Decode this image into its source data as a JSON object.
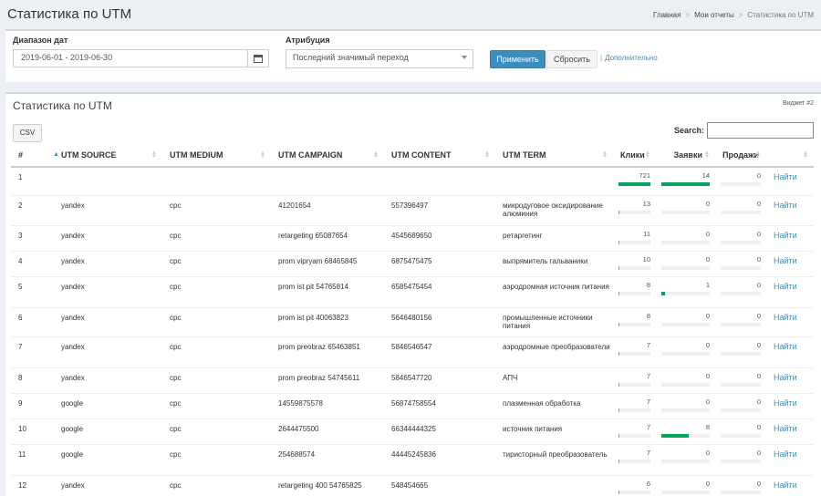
{
  "page_title": "Статистика по UTM",
  "breadcrumb": [
    "Главная",
    "Мои отчеты",
    "Статистика по UTM"
  ],
  "filters": {
    "date_label": "Диапазон дат",
    "date_value": "2019-06-01 - 2019-06-30",
    "attr_label": "Атрибуция",
    "attr_value": "Последний значимый переход",
    "apply": "Применить",
    "reset": "Сбросить",
    "more": "Дополнительно"
  },
  "box": {
    "title": "Статистика по UTM",
    "widget_id": "Виджет #2",
    "csv": "CSV",
    "search_label": "Search:",
    "search_value": ""
  },
  "columns": [
    "#",
    "UTM SOURCE",
    "UTM MEDIUM",
    "UTM CAMPAIGN",
    "UTM CONTENT",
    "UTM TERM",
    "Клики",
    "Заявки",
    "Продажи",
    ""
  ],
  "action_label": "Найти",
  "max": {
    "clicks": 721,
    "leads": 14,
    "sales": 1
  },
  "rows": [
    {
      "n": "1",
      "source": "",
      "medium": "",
      "campaign": "",
      "content": "",
      "term": "",
      "clicks": 721,
      "leads": 14,
      "sales": 0
    },
    {
      "n": "2",
      "source": "yandex",
      "medium": "cpc",
      "campaign": "41201654",
      "content": "557396497",
      "term": "микродуговое оксидирование алюминия",
      "clicks": 13,
      "leads": 0,
      "sales": 0
    },
    {
      "n": "3",
      "source": "yandex",
      "medium": "cpc",
      "campaign": "retargeting 65087654",
      "content": "4545689650",
      "term": "ретаргетинг",
      "clicks": 11,
      "leads": 0,
      "sales": 0
    },
    {
      "n": "4",
      "source": "yandex",
      "medium": "cpc",
      "campaign": "prom vipryam 68465845",
      "content": "6875475475",
      "term": "выпрямитель гальваники",
      "clicks": 10,
      "leads": 0,
      "sales": 0
    },
    {
      "n": "5",
      "source": "yandex",
      "medium": "cpc",
      "campaign": "prom ist pit 54765814",
      "content": "6585475454",
      "term": "аэродромная источник питания",
      "clicks": 8,
      "leads": 1,
      "sales": 0
    },
    {
      "n": "6",
      "source": "yandex",
      "medium": "cpc",
      "campaign": "prom ist pit 40063823",
      "content": "5646480156",
      "term": "промышленные источники питания",
      "clicks": 8,
      "leads": 0,
      "sales": 0
    },
    {
      "n": "7",
      "source": "yandex",
      "medium": "cpc",
      "campaign": "prom preobraz 65463851",
      "content": "5846546547",
      "term": "аэродромные преобразователи",
      "clicks": 7,
      "leads": 0,
      "sales": 0
    },
    {
      "n": "8",
      "source": "yandex",
      "medium": "cpc",
      "campaign": "prom preobraz 54745611",
      "content": "5846547720",
      "term": "АПЧ",
      "clicks": 7,
      "leads": 0,
      "sales": 0
    },
    {
      "n": "9",
      "source": "google",
      "medium": "cpc",
      "campaign": "14559875578",
      "content": "56874758554",
      "term": "плазменная обработка",
      "clicks": 7,
      "leads": 0,
      "sales": 0
    },
    {
      "n": "10",
      "source": "google",
      "medium": "cpc",
      "campaign": "2644475500",
      "content": "66344444325",
      "term": "источник питания",
      "clicks": 7,
      "leads": 8,
      "sales": 0
    },
    {
      "n": "11",
      "source": "google",
      "medium": "cpc",
      "campaign": "254688574",
      "content": "44445245836",
      "term": "тиристорный преобразователь",
      "clicks": 7,
      "leads": 0,
      "sales": 0
    },
    {
      "n": "12",
      "source": "yandex",
      "medium": "cpc",
      "campaign": "retargeting 400 54765825",
      "content": "548454665",
      "term": "",
      "clicks": 6,
      "leads": 0,
      "sales": 0
    }
  ],
  "colors": {
    "accent": "#3c8dbc",
    "bar": "#00a65a"
  }
}
